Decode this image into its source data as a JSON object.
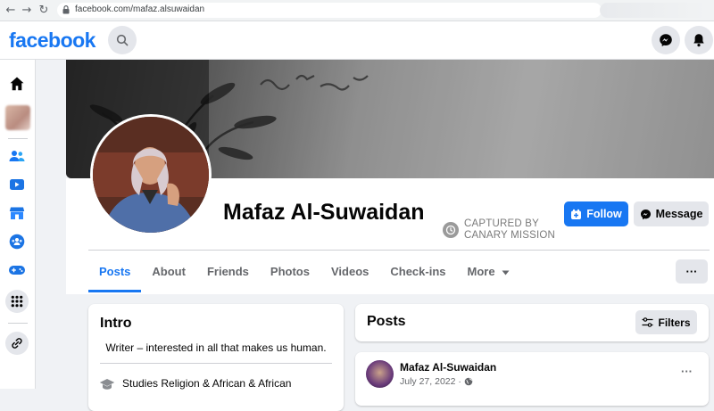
{
  "browser": {
    "url": "facebook.com/mafaz.alsuwaidan"
  },
  "header": {
    "logo": "facebook",
    "icons": [
      "search-icon",
      "messenger-icon",
      "notifications-icon"
    ]
  },
  "left_nav": {
    "icons": [
      "home-icon",
      "profile-avatar",
      "friends-icon",
      "watch-icon",
      "marketplace-icon",
      "groups-icon",
      "gaming-icon",
      "menu-grid-icon",
      "link-icon"
    ]
  },
  "profile": {
    "name": "Mafaz Al-Suwaidan",
    "watermark_line1": "CAPTURED BY",
    "watermark_line2": "CANARY MISSION",
    "follow_label": "Follow",
    "message_label": "Message"
  },
  "tabs": [
    {
      "label": "Posts",
      "active": true
    },
    {
      "label": "About",
      "active": false
    },
    {
      "label": "Friends",
      "active": false
    },
    {
      "label": "Photos",
      "active": false
    },
    {
      "label": "Videos",
      "active": false
    },
    {
      "label": "Check-ins",
      "active": false
    },
    {
      "label": "More",
      "active": false
    }
  ],
  "more_actions_label": "···",
  "intro": {
    "title": "Intro",
    "bio": "Writer – interested in all that makes us human.",
    "study": "Studies Religion & African & African"
  },
  "posts_section": {
    "title": "Posts",
    "filters_label": "Filters"
  },
  "post": {
    "author": "Mafaz Al-Suwaidan",
    "date": "July 27, 2022 ·",
    "options_label": "···"
  },
  "colors": {
    "brand": "#1877f2",
    "background": "#f0f2f5",
    "button_gray": "#e4e6eb"
  }
}
